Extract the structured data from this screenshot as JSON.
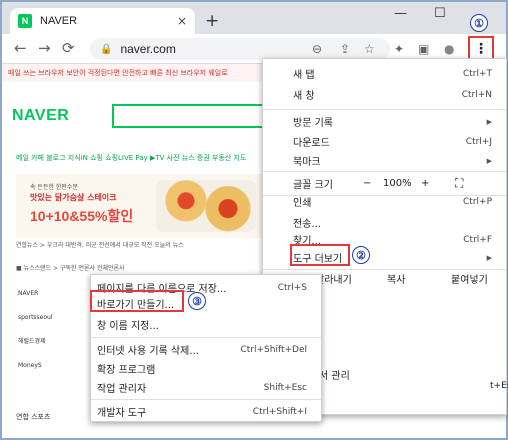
{
  "tab": {
    "favicon": "N",
    "title": "NAVER",
    "close": "×"
  },
  "newtab": "+",
  "window": {
    "minimize": "—",
    "maximize": "☐",
    "close": "✕"
  },
  "nav": {
    "back": "←",
    "forward": "→",
    "reload": "⟳"
  },
  "address": {
    "url": "naver.com",
    "lock": "🔒"
  },
  "toolbar_icons": {
    "zoom": "⊖",
    "share": "⇪",
    "star": "☆",
    "extensions": "✦",
    "sidepanel": "▣",
    "profile": "●",
    "menu": "⋮"
  },
  "markers": {
    "m1": "①",
    "m2": "②",
    "m3": "③"
  },
  "page": {
    "notice": "매일 쓰는 브라우저 보안이 걱정된다면 안전하고 빠른 최신 브라우저 웨일로",
    "logo": "NAVER",
    "services": "메일  카페  블로그  지식iN  쇼핑  쇼핑LIVE  Pay  ▶TV  사전  뉴스  증권  부동산  지도",
    "ad": {
      "line1": "속 든든한 한판수분",
      "line2": "맛있는 닭가슴살 스테이크",
      "line3": "10+10&55%할인"
    },
    "newsline": "연합뉴스 >  우크라 대반격, 러군 전선에서 대규모 작전   오늘의 뉴스",
    "newsbar": "■ 뉴스스탠드 >   구독한 언론사   전체언론사",
    "side": [
      "NAVER",
      "sportsseoul",
      "헤럴드경제",
      "MoneyS"
    ],
    "footer": "연합   스포츠"
  },
  "main_menu": {
    "new_tab": "새 탭",
    "new_tab_sc": "Ctrl+T",
    "new_window": "새 창",
    "new_window_sc": "Ctrl+N",
    "history": "방문 기록",
    "downloads": "다운로드",
    "downloads_sc": "Ctrl+J",
    "bookmarks": "북마크",
    "zoom_label": "글꼴 크기",
    "zoom_minus": "−",
    "zoom_value": "100%",
    "zoom_plus": "+",
    "fullscreen": "⛶",
    "print": "인쇄",
    "print_sc": "Ctrl+P",
    "cast": "전송...",
    "find": "찾기...",
    "find_sc": "Ctrl+F",
    "more_tools": "도구 더보기",
    "cut": "잘라내기",
    "copy": "복사",
    "paste": "붙여넣기",
    "behind_manage": "서 관리"
  },
  "sub_menu": {
    "save_page": "페이지를 다른 이름으로 저장...",
    "save_page_sc": "Ctrl+S",
    "create_shortcut": "바로가기 만들기...",
    "name_window": "창 이름 지정...",
    "clear_data": "인터넷 사용 기록 삭제...",
    "clear_data_sc": "Ctrl+Shift+Del",
    "extensions": "확장 프로그램",
    "task_manager": "작업 관리자",
    "task_manager_sc": "Shift+Esc",
    "dev_tools": "개발자 도구",
    "dev_tools_sc": "Ctrl+Shift+I"
  },
  "clipped": {
    "esc": "t+Esc",
    "ift": "hift+I"
  }
}
